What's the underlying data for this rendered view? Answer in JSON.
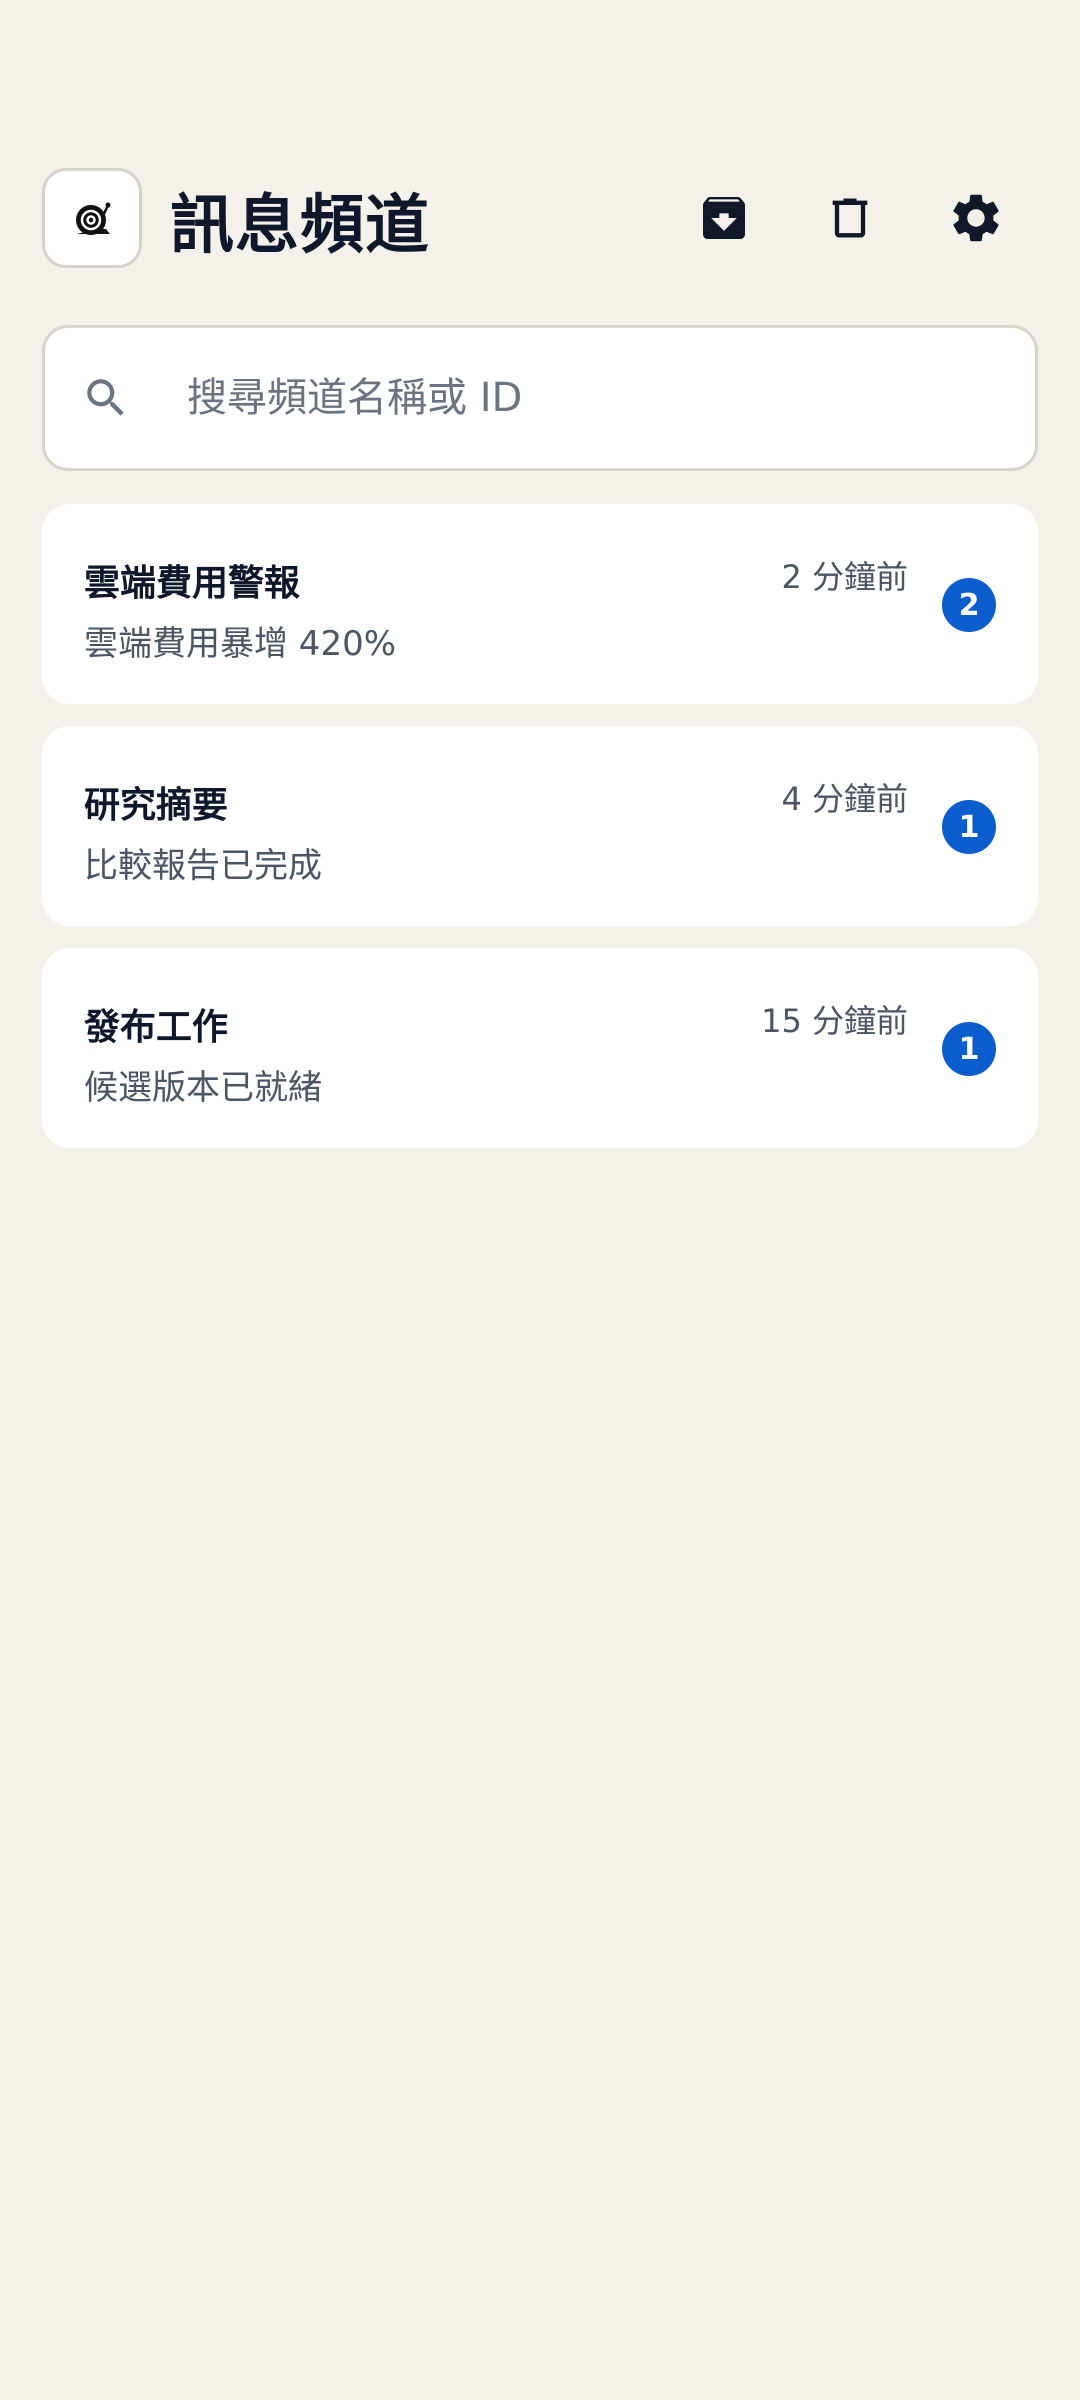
{
  "header": {
    "title": "訊息頻道",
    "logo_icon": "snail-icon",
    "actions": [
      {
        "icon": "archive-icon"
      },
      {
        "icon": "trash-icon"
      },
      {
        "icon": "gear-icon"
      }
    ]
  },
  "search": {
    "placeholder": "搜尋頻道名稱或 ID",
    "value": "",
    "icon": "search-icon"
  },
  "channels": [
    {
      "name": "雲端費用警報",
      "preview": "雲端費用暴增 420%",
      "time": "2 分鐘前",
      "unread": "2"
    },
    {
      "name": "研究摘要",
      "preview": "比較報告已完成",
      "time": "4 分鐘前",
      "unread": "1"
    },
    {
      "name": "發布工作",
      "preview": "候選版本已就緒",
      "time": "15 分鐘前",
      "unread": "1"
    }
  ],
  "colors": {
    "background": "#f4f1eb",
    "card": "#ffffff",
    "accent": "#0b5ccc",
    "text_primary": "#0f172a",
    "text_secondary": "#4b5563"
  }
}
